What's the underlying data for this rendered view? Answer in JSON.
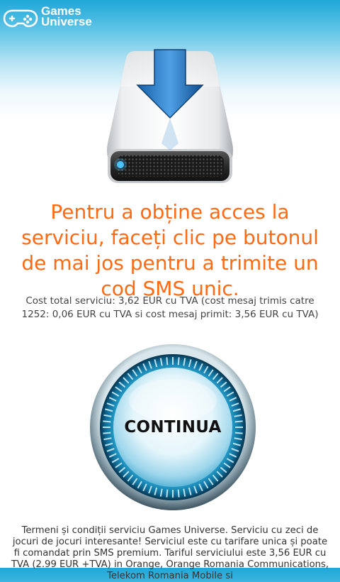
{
  "brand": {
    "line1": "Games",
    "line2": "Universe"
  },
  "headline": "Pentru a obține acces la serviciu, faceți clic pe butonul de mai jos pentru a trimite un cod SMS unic.",
  "cost_text": "Cost total serviciu: 3,62 EUR cu TVA (cost mesaj trimis catre 1252: 0,06 EUR cu TVA si cost mesaj primit: 3,56 EUR cu TVA)",
  "button_label": "CONTINUA",
  "terms_text": "Termeni și condiții serviciu Games Universe. Serviciu cu zeci de jocuri de jocuri interesante! Serviciul este cu tarifare unica și poate fi comandat prin SMS premium. Tariful serviciului este 3,56 EUR cu TVA (2.99 EUR +TVA) in Orange, Orange Romania Communications, Telekom Romania Mobile si",
  "icons": {
    "logo": "gamepad-icon",
    "hero": "download-drive-icon"
  },
  "colors": {
    "headline": "#ff6a13",
    "header_blue": "#1fa7d8"
  }
}
